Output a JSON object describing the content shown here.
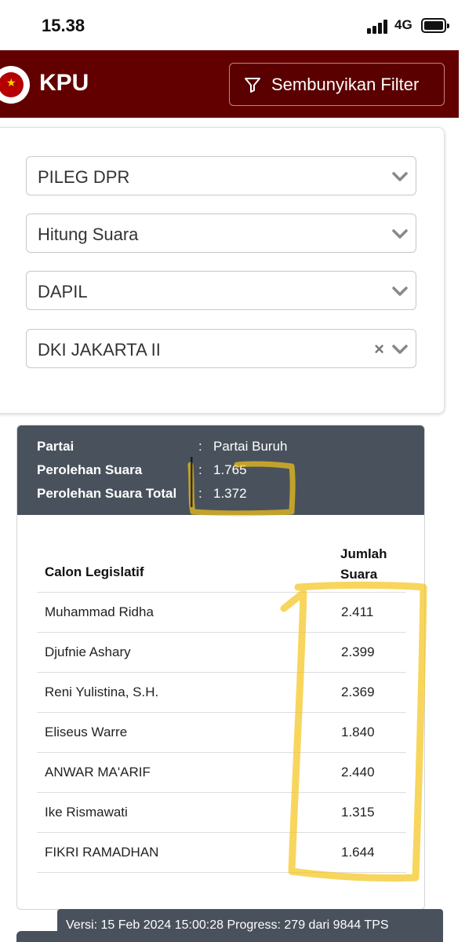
{
  "status_bar": {
    "time": "15.38",
    "network": "4G"
  },
  "header": {
    "brand": "KPU",
    "filter_button": "Sembunyikan Filter"
  },
  "filters": [
    {
      "value": "PILEG DPR",
      "clearable": false
    },
    {
      "value": "Hitung Suara",
      "clearable": false
    },
    {
      "value": "DAPIL",
      "clearable": false
    },
    {
      "value": "DKI JAKARTA II",
      "clearable": true
    }
  ],
  "summary": [
    {
      "label": "Partai",
      "value": "Partai Buruh"
    },
    {
      "label": "Perolehan Suara",
      "value": "1.765"
    },
    {
      "label": "Perolehan Suara Total",
      "value": "1.372"
    }
  ],
  "table": {
    "headers": {
      "name": "Calon Legislatif",
      "votes_line1": "Jumlah",
      "votes_line2": "Suara"
    },
    "rows": [
      {
        "name": "Muhammad Ridha",
        "votes": "2.411"
      },
      {
        "name": "Djufnie Ashary",
        "votes": "2.399"
      },
      {
        "name": "Reni Yulistina, S.H.",
        "votes": "2.369"
      },
      {
        "name": "Eliseus Warre",
        "votes": "1.840"
      },
      {
        "name": "ANWAR MA'ARIF",
        "votes": "2.440"
      },
      {
        "name": "Ike Rismawati",
        "votes": "1.315"
      },
      {
        "name": "FIKRI RAMADHAN",
        "votes": "1.644"
      }
    ]
  },
  "footer": {
    "version_text": "Versi: 15 Feb 2024 15:00:28 Progress: 279 dari 9844 TPS"
  },
  "colors": {
    "header_bg": "#620000",
    "panel_bg": "#49525c",
    "highlight": "#f5c518"
  }
}
